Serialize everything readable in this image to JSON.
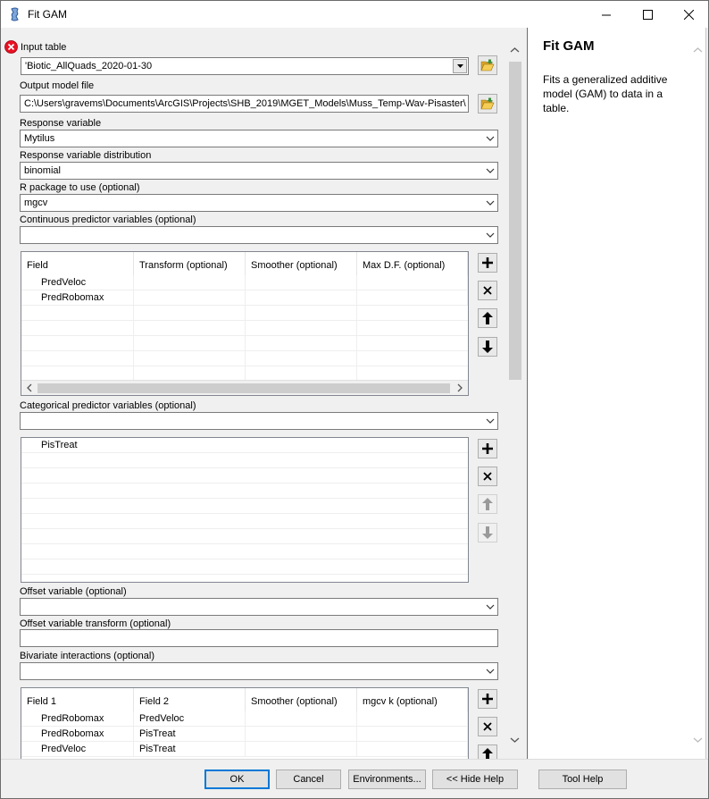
{
  "window": {
    "title": "Fit GAM"
  },
  "form": {
    "input_table_label": "Input table",
    "input_table_value": "'Biotic_AllQuads_2020-01-30",
    "output_model_label": "Output model file",
    "output_model_value": "C:\\Users\\gravems\\Documents\\ArcGIS\\Projects\\SHB_2019\\MGET_Models\\Muss_Temp-Wav-Pisaster\\Mu",
    "response_label": "Response variable",
    "response_value": "Mytilus",
    "distribution_label": "Response variable distribution",
    "distribution_value": "binomial",
    "rpackage_label": "R package to use (optional)",
    "rpackage_value": "mgcv",
    "continuous_label": "Continuous predictor variables (optional)",
    "continuous_value": "",
    "continuous_grid": {
      "headers": [
        "Field",
        "Transform (optional)",
        "Smoother (optional)",
        "Max D.F. (optional)"
      ],
      "rows": [
        "PredVeloc",
        "PredRobomax"
      ]
    },
    "categorical_label": "Categorical predictor variables (optional)",
    "categorical_value": "",
    "categorical_rows": [
      "PisTreat"
    ],
    "offset_label": "Offset variable (optional)",
    "offset_value": "",
    "offset_transform_label": "Offset variable transform (optional)",
    "offset_transform_value": "",
    "bivariate_label": "Bivariate interactions (optional)",
    "bivariate_value": "",
    "bivariate_grid": {
      "headers": [
        "Field 1",
        "Field 2",
        "Smoother (optional)",
        "mgcv k (optional)"
      ],
      "rows": [
        {
          "f1": "PredRobomax",
          "f2": "PredVeloc"
        },
        {
          "f1": "PredRobomax",
          "f2": "PisTreat"
        },
        {
          "f1": "PredVeloc",
          "f2": "PisTreat"
        }
      ]
    }
  },
  "help": {
    "title": "Fit GAM",
    "description": "Fits a generalized additive model (GAM) to data in a table."
  },
  "buttons": {
    "ok": "OK",
    "cancel": "Cancel",
    "environments": "Environments...",
    "hide_help": "<< Hide Help",
    "tool_help": "Tool Help"
  },
  "colors": {
    "error": "#e81123",
    "focus_border": "#0078d7",
    "folder": "#e8b73c"
  }
}
